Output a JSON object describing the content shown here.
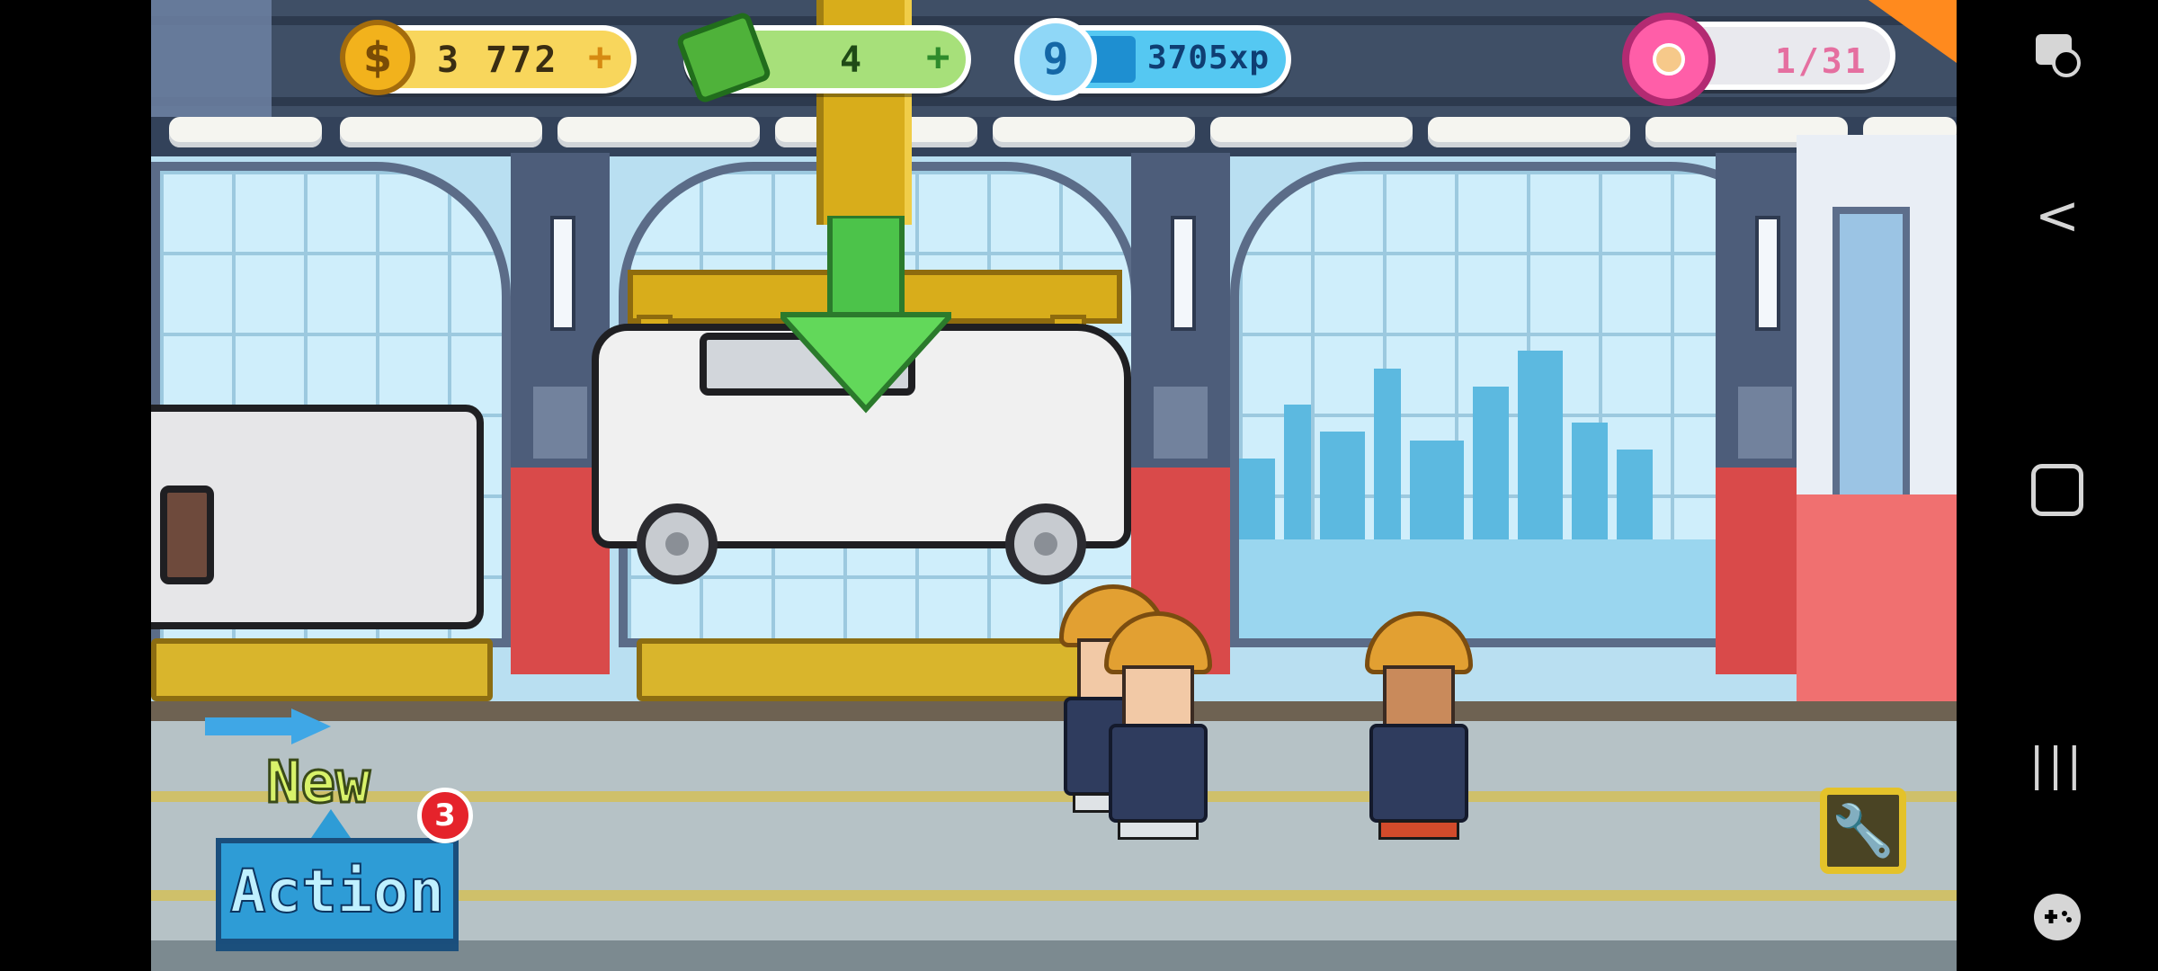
{
  "hud": {
    "coins": "3 772",
    "cash": "4",
    "level": "9",
    "xp": "3705xp",
    "donuts": "1/31",
    "plus": "+"
  },
  "action_panel": {
    "new_label": "New",
    "action_label": "Action",
    "badge_count": "3"
  },
  "icons": {
    "coin": "dollar-coin-icon",
    "cash": "banknote-icon",
    "xp": "xp-star-icon",
    "donut": "donut-icon",
    "wrench": "wrench-icon",
    "nav_screenshot": "screenshot-icon",
    "nav_back": "back-icon",
    "nav_home": "home-icon",
    "nav_recents": "recents-icon",
    "nav_gamepad": "game-controls-icon"
  },
  "colors": {
    "coin_pill": "#f8d65c",
    "cash_pill": "#a7e07a",
    "xp_pill": "#55c8f2",
    "donut_pill": "#e9e9ee",
    "action": "#2e9cd6",
    "badge": "#e5232b"
  },
  "xp_progress": 0.25,
  "symbols": {
    "dollar": "$",
    "wrench": "🔧",
    "back": "<",
    "recents": "|||"
  }
}
